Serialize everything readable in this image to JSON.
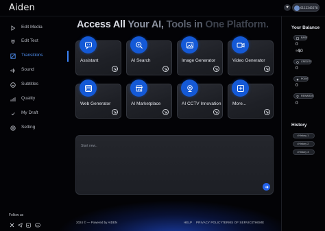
{
  "app": {
    "name": "Aiden"
  },
  "header": {
    "user_id": "0112345678"
  },
  "sidebar": {
    "items": [
      {
        "label": "Edit Media",
        "icon": "play-icon"
      },
      {
        "label": "Edit Text",
        "icon": "text-icon"
      },
      {
        "label": "Transitions",
        "icon": "transitions-icon",
        "active": true
      },
      {
        "label": "Sound",
        "icon": "sound-icon"
      },
      {
        "label": "Subtitles",
        "icon": "subtitles-icon"
      },
      {
        "label": "Quality",
        "icon": "quality-icon"
      },
      {
        "label": "My Draft",
        "icon": "draft-icon"
      },
      {
        "label": "Setting",
        "icon": "gear-icon"
      }
    ],
    "follow_label": "Follow us",
    "socials": [
      "x-icon",
      "telegram-icon",
      "linkedin-icon",
      "discord-icon"
    ]
  },
  "hero": {
    "w1": "Access All",
    "w2": "Your AI,",
    "w3": "Tools in",
    "w4": "One Platform."
  },
  "cards": [
    {
      "title": "Assistant",
      "icon": "chat-icon"
    },
    {
      "title": "AI Search",
      "icon": "search-icon"
    },
    {
      "title": "Image Generator",
      "icon": "image-icon"
    },
    {
      "title": "Video Generator",
      "icon": "video-icon"
    },
    {
      "title": "Web Generator",
      "icon": "web-icon"
    },
    {
      "title": "AI Marketplace",
      "icon": "store-icon"
    },
    {
      "title": "AI CCTV Innovation",
      "icon": "cctv-icon"
    },
    {
      "title": "More...",
      "icon": "more-icon"
    }
  ],
  "prompt": {
    "placeholder": "Start new.."
  },
  "footer": {
    "copyright": "2024 © — Powered by AIDEN",
    "links": [
      "HELP",
      "PRIVACY POLICY",
      "TERMS OF SERVICE",
      "THEME"
    ]
  },
  "balance": {
    "title": "Your Balance",
    "items": [
      {
        "chip": "BASE",
        "values": [
          "0",
          "≈$0"
        ]
      },
      {
        "chip": "CREDITS",
        "values": [
          "0"
        ]
      },
      {
        "chip": "POINT",
        "values": [
          "0"
        ]
      },
      {
        "chip": "REWARDS",
        "values": [
          "0"
        ]
      }
    ]
  },
  "history": {
    "title": "History",
    "items": [
      "History 1",
      "History 2",
      "History 3"
    ]
  },
  "colors": {
    "accent": "#3b82f6",
    "badge": "#1459d6",
    "background": "#030306"
  }
}
